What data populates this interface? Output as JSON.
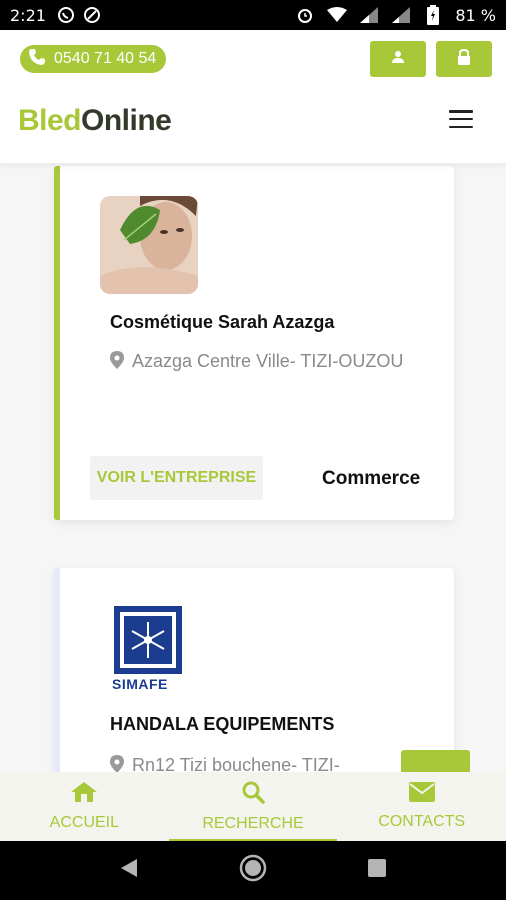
{
  "status_bar": {
    "time": "2:21",
    "battery": "81 %"
  },
  "header": {
    "phone": "0540 71 40 54",
    "logo_bled": "Bled",
    "logo_online": "Online"
  },
  "listings": [
    {
      "name": "Cosmétique Sarah Azazga",
      "address": "Azazga Centre Ville- TIZI-OUZOU",
      "button": "VOIR L'ENTREPRISE",
      "category": "Commerce"
    },
    {
      "name": "HANDALA EQUIPEMENTS",
      "address": "Rn12 Tizi bouchene- TIZI-",
      "logo_text": "SIMAFE"
    }
  ],
  "bottom_nav": [
    {
      "label": "ACCUEIL",
      "icon": "home-icon"
    },
    {
      "label": "RECHERCHE",
      "icon": "search-icon"
    },
    {
      "label": "CONTACTS",
      "icon": "mail-icon"
    }
  ],
  "colors": {
    "accent": "#a8c83a",
    "secondary_accent": "#e5e9fb"
  }
}
